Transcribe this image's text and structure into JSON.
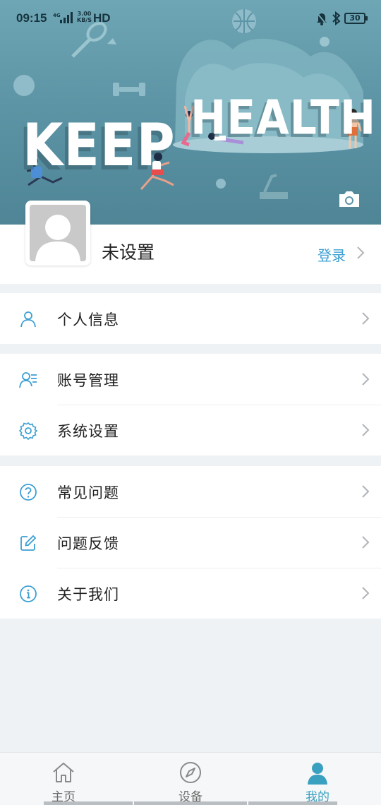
{
  "status_bar": {
    "time": "09:15",
    "network": "⁴ᴳ",
    "speed_value": "3.00",
    "speed_unit": "KB/S",
    "hd": "HD",
    "battery": "30"
  },
  "banner": {
    "word_keep": "KEEP",
    "word_health": "HEALTH",
    "camera_icon": "camera-icon"
  },
  "profile": {
    "username": "未设置",
    "login_label": "登录"
  },
  "menu": {
    "group1": [
      {
        "label": "个人信息",
        "icon": "person-icon"
      }
    ],
    "group2": [
      {
        "label": "账号管理",
        "icon": "account-list-icon"
      },
      {
        "label": "系统设置",
        "icon": "gear-icon"
      }
    ],
    "group3": [
      {
        "label": "常见问题",
        "icon": "question-icon"
      },
      {
        "label": "问题反馈",
        "icon": "edit-icon"
      },
      {
        "label": "关于我们",
        "icon": "info-icon"
      }
    ]
  },
  "tabs": [
    {
      "label": "主页",
      "icon": "home-icon",
      "active": false
    },
    {
      "label": "设备",
      "icon": "compass-icon",
      "active": false
    },
    {
      "label": "我的",
      "icon": "user-icon",
      "active": true
    }
  ],
  "colors": {
    "accent": "#3b9fd3",
    "tab_active": "#3aa0c0",
    "banner": "#5d95a6"
  }
}
